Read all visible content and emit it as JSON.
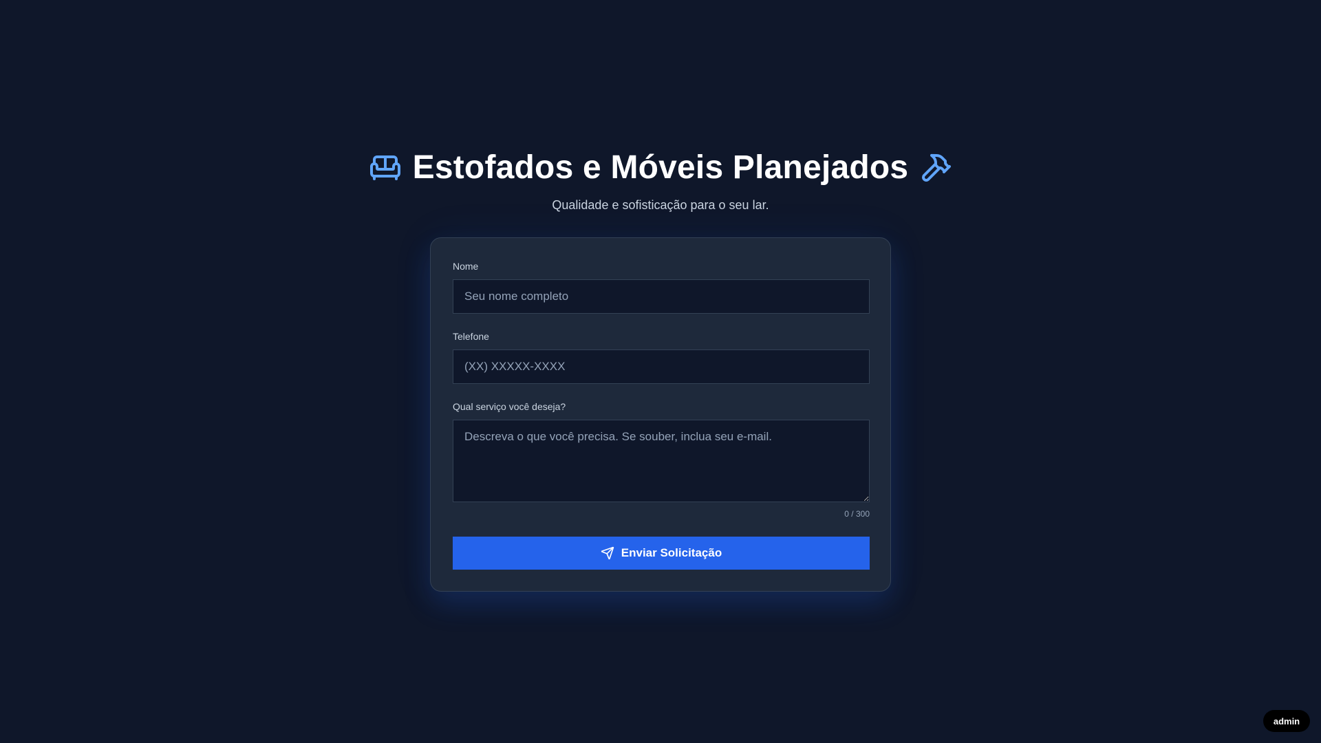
{
  "header": {
    "title": "Estofados e Móveis Planejados",
    "subtitle": "Qualidade e sofisticação para o seu lar.",
    "left_icon": "sofa-icon",
    "right_icon": "hammer-icon"
  },
  "form": {
    "name": {
      "label": "Nome",
      "placeholder": "Seu nome completo",
      "value": ""
    },
    "phone": {
      "label": "Telefone",
      "placeholder": "(XX) XXXXX-XXXX",
      "value": ""
    },
    "service": {
      "label": "Qual serviço você deseja?",
      "placeholder": "Descreva o que você precisa. Se souber, inclua seu e-mail.",
      "value": "",
      "counter": "0 / 300"
    },
    "submit": {
      "label": "Enviar Solicitação",
      "icon": "send-icon"
    }
  },
  "admin": {
    "label": "admin"
  },
  "colors": {
    "background": "#0f172a",
    "card": "#1e293b",
    "accent": "#2563eb",
    "icon_accent": "#60a5fa"
  }
}
